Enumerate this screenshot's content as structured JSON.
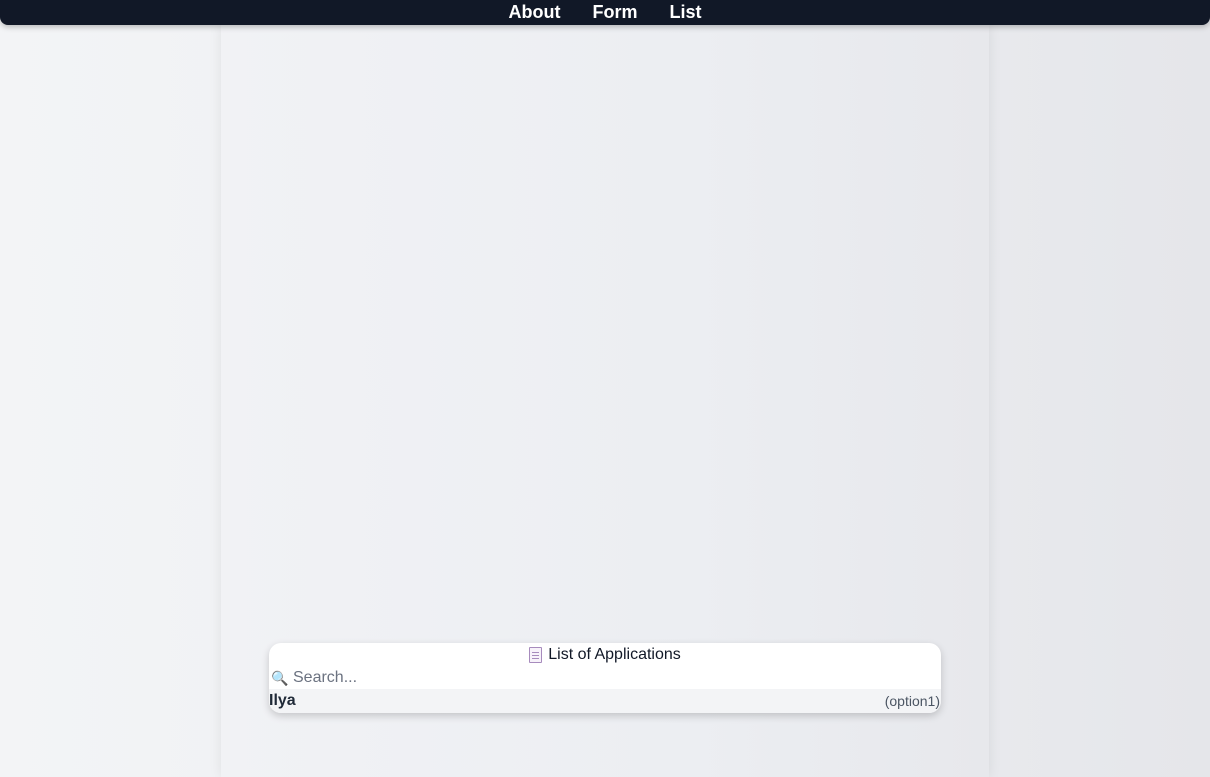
{
  "nav": {
    "items": [
      {
        "label": "About"
      },
      {
        "label": "Form"
      },
      {
        "label": "List"
      }
    ]
  },
  "list_card": {
    "icon": "document-icon",
    "title": "List of Applications",
    "search": {
      "icon": "search-icon",
      "placeholder": "Search...",
      "value": ""
    },
    "items": [
      {
        "name": "Ilya",
        "meta": "(option1)"
      }
    ]
  },
  "colors": {
    "topbar": "#111827",
    "nav_text": "#ffffff",
    "card_bg": "#ffffff",
    "row_bg": "#f3f4f6"
  }
}
